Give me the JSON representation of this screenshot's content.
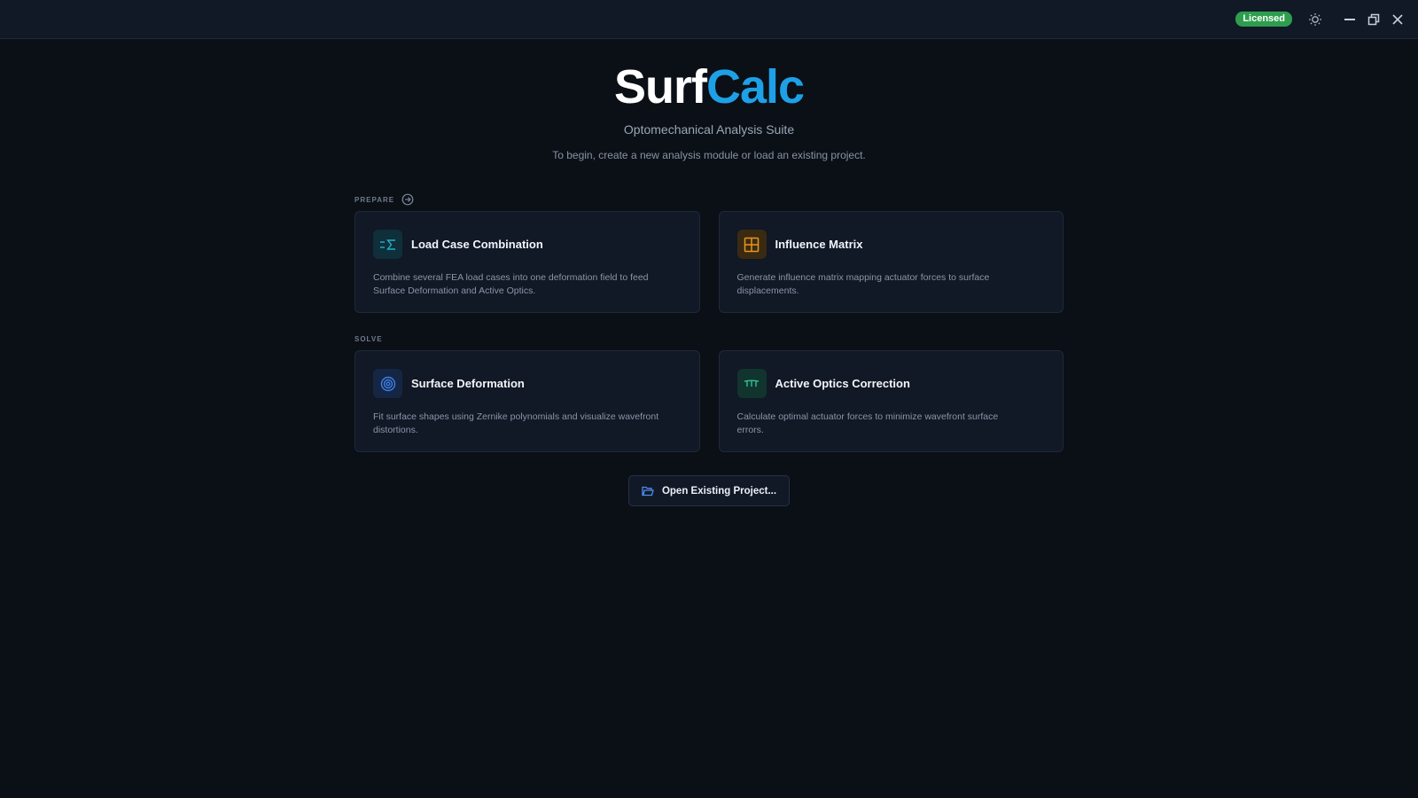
{
  "titlebar": {
    "license_badge": "Licensed",
    "icons": [
      "brightness-icon",
      "minimize-icon",
      "restore-icon",
      "close-icon"
    ]
  },
  "hero": {
    "brand_part1": "Surf",
    "brand_part2": "Calc",
    "subtitle": "Optomechanical Analysis Suite",
    "tagline": "To begin, create a new analysis module or load an existing project."
  },
  "sections": {
    "prepare": {
      "label": "PREPARE",
      "cards": [
        {
          "title": "Load Case Combination",
          "description": "Combine several FEA load cases into one deformation field to feed Surface Deformation and Active Optics.",
          "icon": "sigma-icon",
          "accent": "#1fb3c9"
        },
        {
          "title": "Influence Matrix",
          "description": "Generate influence matrix mapping actuator forces to surface displacements.",
          "icon": "grid-icon",
          "accent": "#e8961f"
        }
      ]
    },
    "solve": {
      "label": "SOLVE",
      "cards": [
        {
          "title": "Surface Deformation",
          "description": "Fit surface shapes using Zernike polynomials and visualize wavefront distortions.",
          "icon": "target-icon",
          "accent": "#3f7fe8"
        },
        {
          "title": "Active Optics Correction",
          "description": "Calculate optimal actuator forces to minimize wavefront surface errors.",
          "icon": "actuator-icon",
          "accent": "#2fc28f"
        }
      ]
    }
  },
  "open_button": {
    "label": "Open Existing Project...",
    "icon": "folder-icon"
  },
  "colors": {
    "background": "#0b0f16",
    "panel": "#111826",
    "brand_accent": "#1ea0e6",
    "badge": "#2e9e4e"
  }
}
